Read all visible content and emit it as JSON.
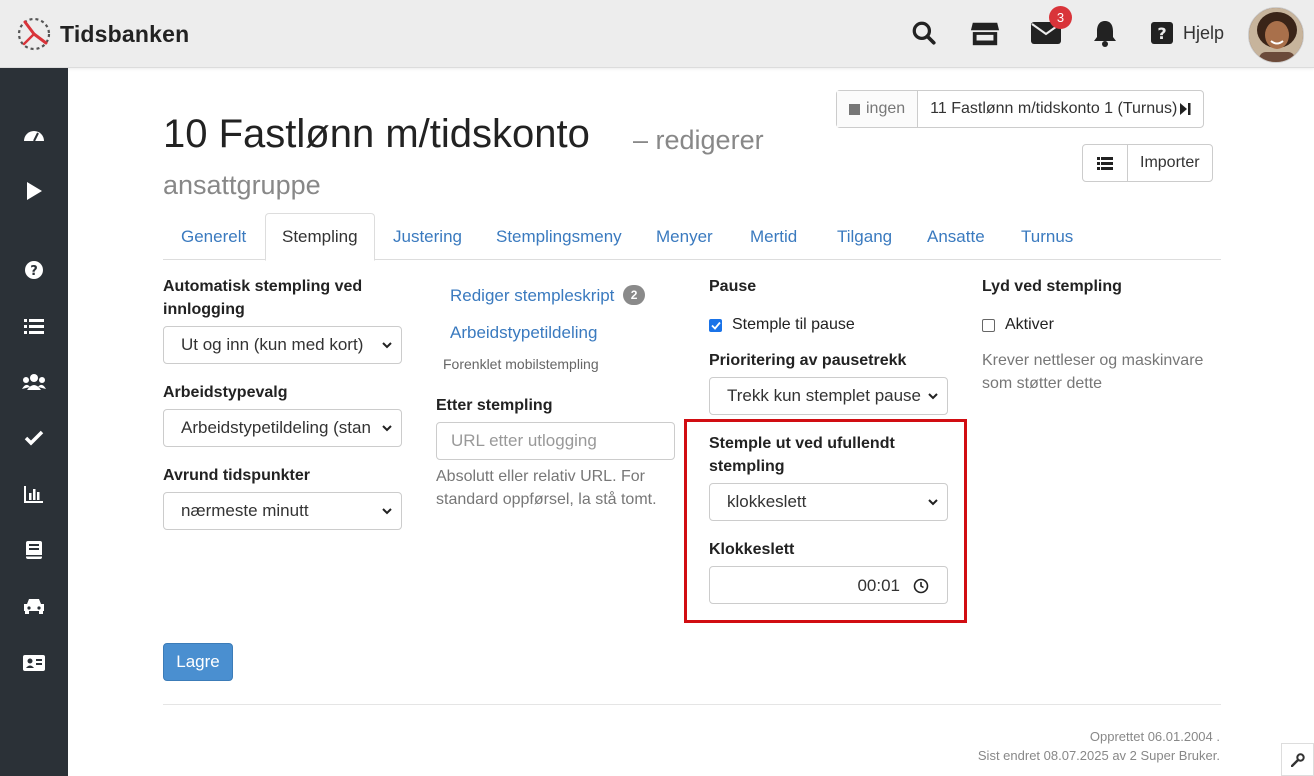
{
  "brand": {
    "name": "Tidsbanken"
  },
  "topbar": {
    "mail_count": "3",
    "help_label": "Hjelp"
  },
  "header": {
    "title": "10 Fastlønn m/tidskonto",
    "subtitle_1": "– redigerer",
    "subtitle_2": "ansattgruppe",
    "nav_none": "ingen",
    "nav_next": "11 Fastlønn m/tidskonto 1 (Turnus)",
    "import_label": "Importer"
  },
  "tabs": [
    {
      "label": "Generelt"
    },
    {
      "label": "Stempling"
    },
    {
      "label": "Justering"
    },
    {
      "label": "Stemplingsmeny"
    },
    {
      "label": "Menyer"
    },
    {
      "label": "Mertid"
    },
    {
      "label": "Tilgang"
    },
    {
      "label": "Ansatte"
    },
    {
      "label": "Turnus"
    }
  ],
  "col1": {
    "auto_label_1": "Automatisk stempling ved",
    "auto_label_2": "innlogging",
    "auto_value": "Ut og inn (kun med kort)",
    "worktype_label": "Arbeidstypevalg",
    "worktype_value": "Arbeidstypetildeling (stan",
    "round_label": "Avrund tidspunkter",
    "round_value": "nærmeste minutt"
  },
  "col2": {
    "script_link": "Rediger stempleskript",
    "script_count": "2",
    "worktype_link": "Arbeidstypetildeling",
    "simplified": "Forenklet mobilstempling",
    "after_label": "Etter stempling",
    "after_placeholder": "URL etter utlogging",
    "after_help_1": "Absolutt eller relativ URL. For",
    "after_help_2": "standard oppførsel, la stå tomt."
  },
  "col3": {
    "pause_label": "Pause",
    "pause_check": "Stemple til pause",
    "priority_label": "Prioritering av pausetrekk",
    "priority_value": "Trekk kun stemplet pause",
    "incomplete_label_1": "Stemple ut ved ufullendt",
    "incomplete_label_2": "stempling",
    "incomplete_value": "klokkeslett",
    "time_label": "Klokkeslett",
    "time_value": "00:01"
  },
  "col4": {
    "sound_label": "Lyd ved stempling",
    "activate_label": "Aktiver",
    "sound_help_1": "Krever nettleser og maskinvare",
    "sound_help_2": "som støtter dette"
  },
  "actions": {
    "save_label": "Lagre"
  },
  "footer": {
    "created": "Opprettet 06.01.2004 .",
    "modified": "Sist endret 08.07.2025 av 2 Super Bruker."
  },
  "colors": {
    "accent": "#3a7abf",
    "sidebar": "#2b3137",
    "highlight": "#d10d12",
    "save": "#4a8fd0"
  }
}
